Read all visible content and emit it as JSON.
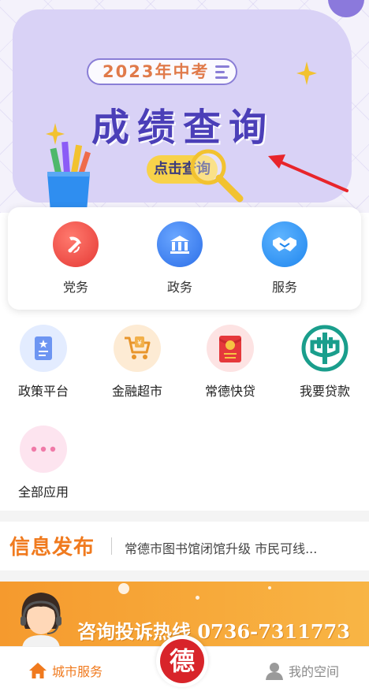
{
  "banner": {
    "year_label": "2023年中考",
    "title": "成绩查询",
    "button_label": "点击查询"
  },
  "services": [
    {
      "label": "党务",
      "icon": "party-emblem-icon",
      "color": "#ef4444"
    },
    {
      "label": "政务",
      "icon": "building-icon",
      "color": "#3b7cf0"
    },
    {
      "label": "服务",
      "icon": "handshake-icon",
      "color": "#2d8ef0"
    }
  ],
  "apps": [
    {
      "label": "政策平台",
      "icon": "document-icon"
    },
    {
      "label": "金融超市",
      "icon": "shopping-cart-icon"
    },
    {
      "label": "常德快贷",
      "icon": "red-envelope-icon"
    },
    {
      "label": "我要贷款",
      "icon": "abc-bank-logo-icon"
    },
    {
      "label": "全部应用",
      "icon": "more-dots-icon"
    }
  ],
  "news": {
    "title": "信息发布",
    "headline": "常德市图书馆闭馆升级 市民可线..."
  },
  "hotline": {
    "text": "咨询投诉热线 0736-7311773"
  },
  "tabbar": {
    "city_service": "城市服务",
    "center_logo": "德",
    "my_space": "我的空间"
  },
  "colors": {
    "accent_orange": "#f07a1e",
    "banner_title": "#4b3fb8",
    "brand_red": "#d8242a"
  }
}
